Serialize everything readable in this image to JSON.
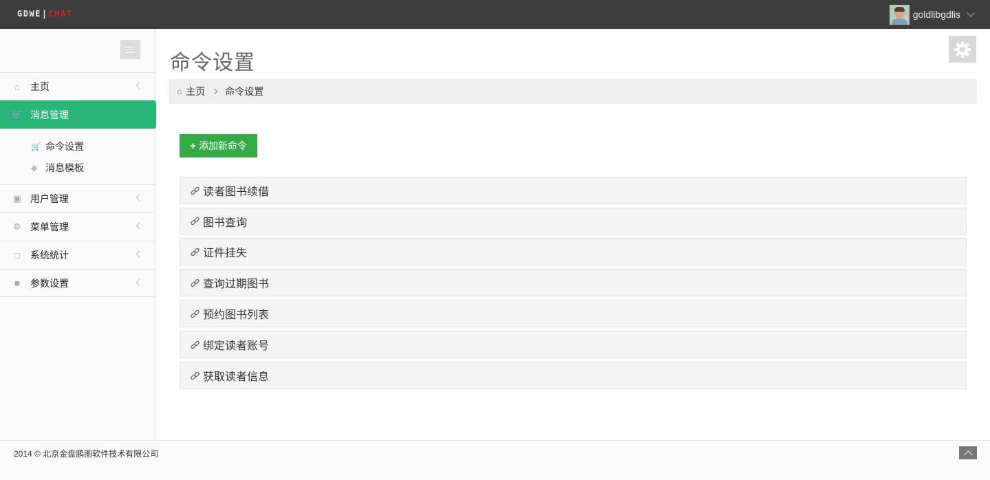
{
  "header": {
    "logo_left": "GDWE",
    "logo_sep": "|",
    "logo_right": "CHAT",
    "username": "goldlibgdlis"
  },
  "sidebar": {
    "items": [
      {
        "label": "主页",
        "icon": "home-icon"
      },
      {
        "label": "消息管理",
        "icon": "cart-icon",
        "active": true
      },
      {
        "label": "用户管理",
        "icon": "gift-icon"
      },
      {
        "label": "菜单管理",
        "icon": "gears-icon"
      },
      {
        "label": "系统统计",
        "icon": "bookmark-icon"
      },
      {
        "label": "参数设置",
        "icon": "puzzle-icon"
      }
    ],
    "submenu": [
      {
        "label": "命令设置",
        "icon": "cart-icon"
      },
      {
        "label": "消息模板",
        "icon": "tags-icon"
      }
    ]
  },
  "main": {
    "title": "命令设置",
    "breadcrumb": {
      "home": "主页",
      "current": "命令设置"
    },
    "add_button": "添加新命令",
    "commands": [
      "读者图书续借",
      "图书查询",
      "证件挂失",
      "查询过期图书",
      "预约图书列表",
      "绑定读者账号",
      "获取读者信息"
    ]
  },
  "footer": {
    "copyright": "2014 © 北京金盘鹏图软件技术有限公司"
  },
  "colors": {
    "topbar": "#3d3d3d",
    "active": "#28b779",
    "add_button": "#35aa47",
    "logo_accent": "#e02222"
  }
}
